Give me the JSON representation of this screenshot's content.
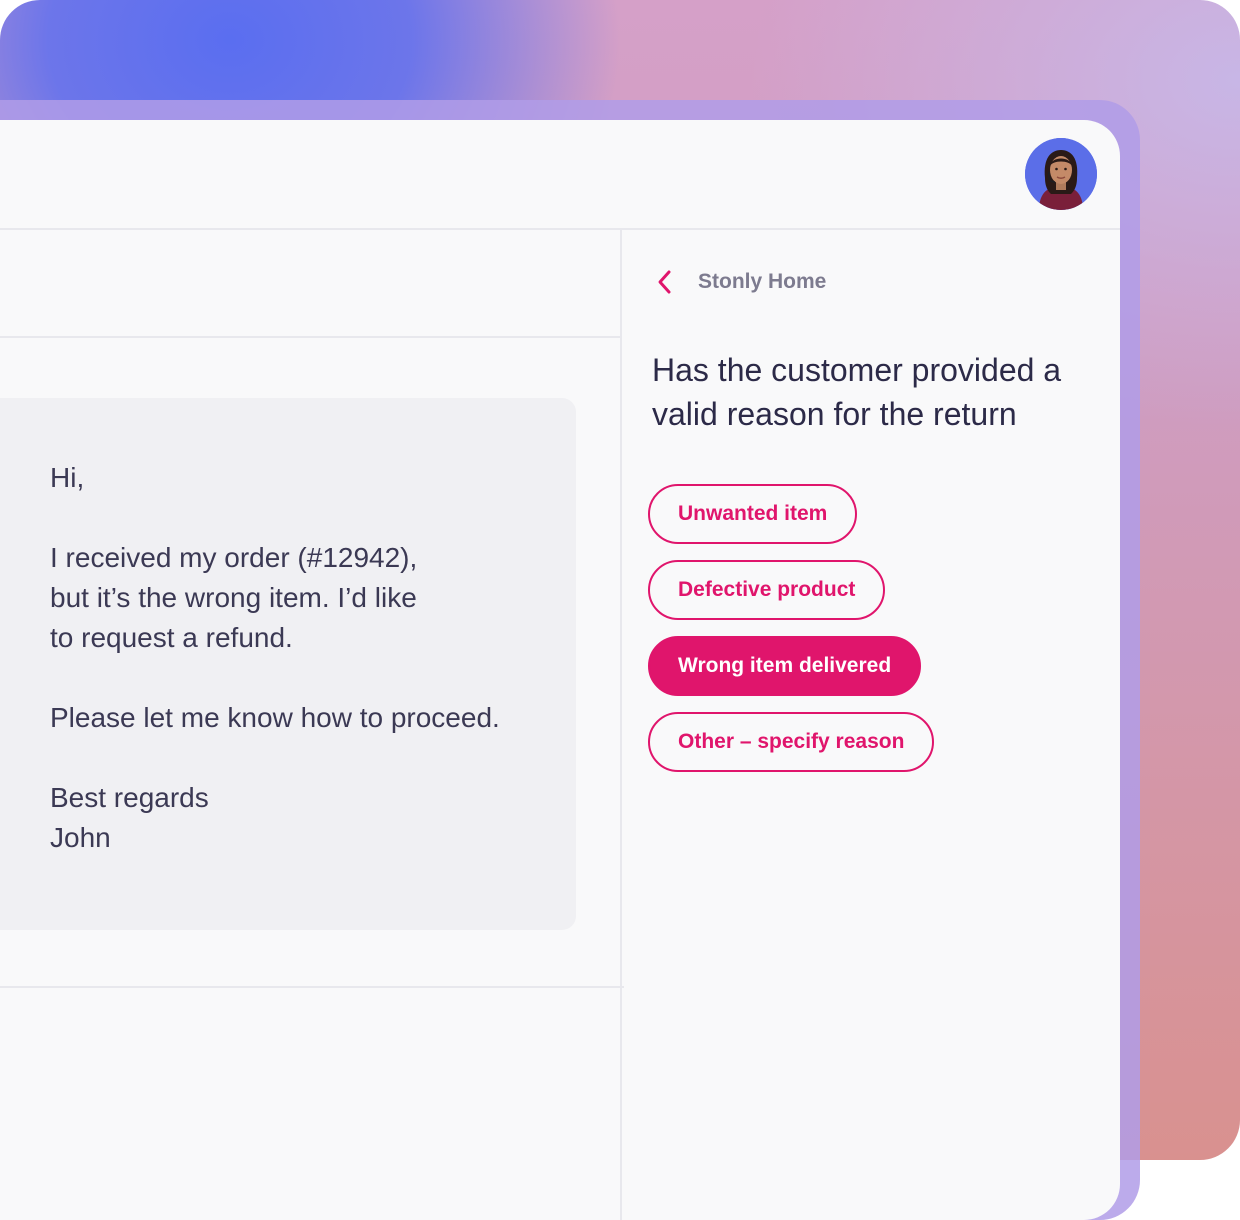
{
  "email": {
    "lines": [
      "Hi,",
      "",
      "I received my order (#12942),",
      "but it’s the wrong item. I’d like",
      "to request a refund.",
      "",
      "Please let me know how to proceed.",
      "",
      "Best regards",
      "John"
    ]
  },
  "guide": {
    "back_label": "Stonly Home",
    "question": "Has the customer provided a valid reason for the return",
    "options": [
      {
        "label": "Unwanted item",
        "selected": false
      },
      {
        "label": "Defective product",
        "selected": false
      },
      {
        "label": "Wrong item delivered",
        "selected": true
      },
      {
        "label": "Other – specify reason",
        "selected": false
      }
    ]
  },
  "icons": {
    "back": "chevron-left-icon",
    "avatar": "agent-avatar"
  },
  "colors": {
    "accent": "#e0156c",
    "text_dark": "#2c2a48",
    "text_muted": "#7d7b8f",
    "card_bg": "#f0f0f3",
    "panel_bg": "#f9f9fa"
  }
}
